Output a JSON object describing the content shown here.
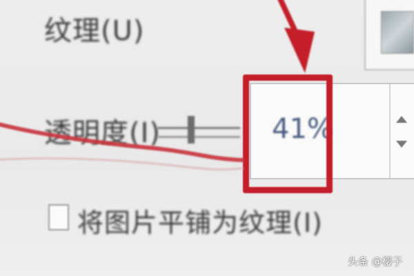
{
  "panel": {
    "texture_label": "纹理(U)",
    "opacity_label": "透明度(I)",
    "opacity_value": "41%",
    "opacity_percent": 41,
    "tile_checkbox_label": "将图片平铺为纹理(I)",
    "tile_checkbox_checked": false
  },
  "icons": {
    "texture_swatch": "texture-swatch-icon",
    "spin_up": "spin-up-icon",
    "spin_down": "spin-down-icon"
  },
  "annotation": {
    "highlight_color": "#c41e2a",
    "arrow_color": "#c41e2a"
  },
  "watermark": {
    "text": "头条 @樱子"
  }
}
